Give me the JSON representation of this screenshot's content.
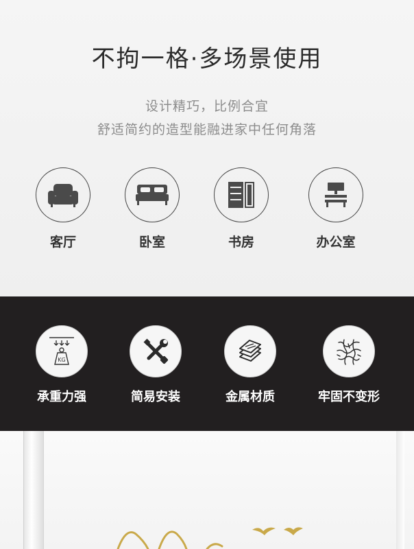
{
  "header": {
    "title": "不拘一格·多场景使用",
    "subtitle_line1": "设计精巧，比例合宜",
    "subtitle_line2": "舒适简约的造型能融进家中任何角落"
  },
  "scenes": [
    {
      "label": "客厅",
      "icon": "sofa-icon"
    },
    {
      "label": "卧室",
      "icon": "bed-icon"
    },
    {
      "label": "书房",
      "icon": "bookshelf-icon"
    },
    {
      "label": "办公室",
      "icon": "office-desk-icon"
    }
  ],
  "features": [
    {
      "label": "承重力强",
      "icon": "weight-kg-icon",
      "icon_text": "KG"
    },
    {
      "label": "简易安装",
      "icon": "tools-icon"
    },
    {
      "label": "金属材质",
      "icon": "metal-layers-icon"
    },
    {
      "label": "牢固不变形",
      "icon": "crackle-pattern-icon"
    }
  ],
  "colors": {
    "band_background": "#221f20",
    "accent_gold": "#c9a94a"
  }
}
